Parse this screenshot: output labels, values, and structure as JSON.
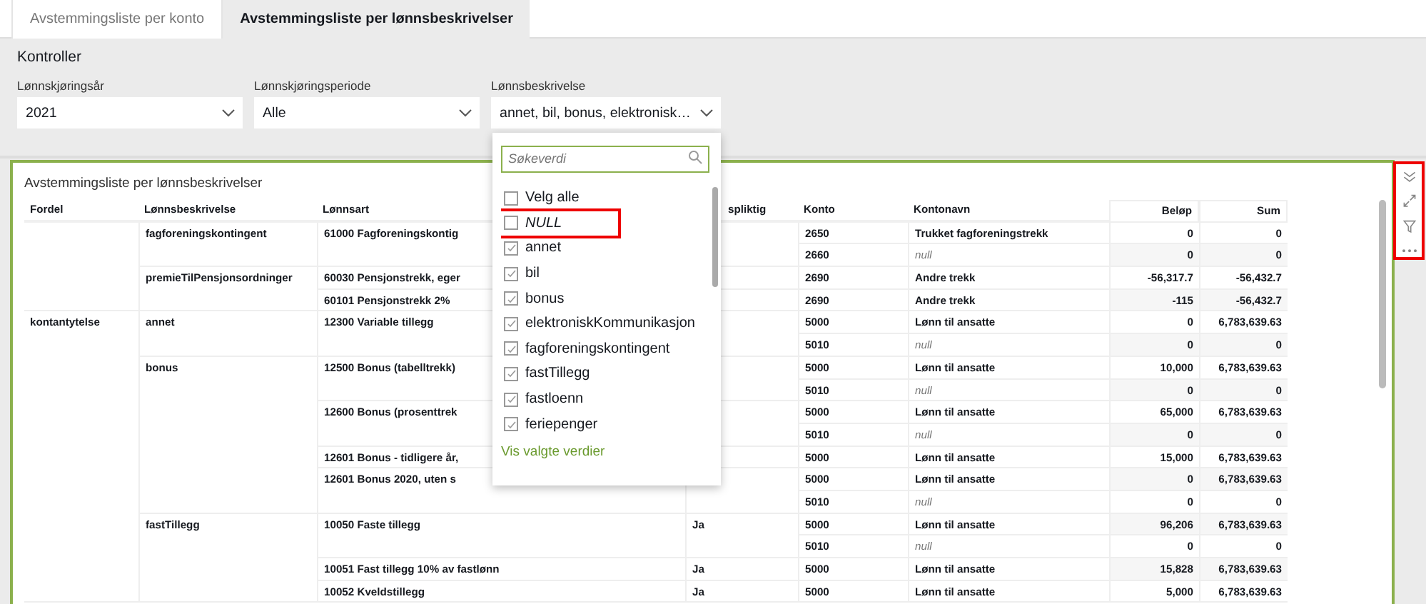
{
  "tabs": [
    {
      "label": "Avstemmingsliste per konto",
      "selected": false
    },
    {
      "label": "Avstemmingsliste per lønnsbeskrivelser",
      "selected": true
    }
  ],
  "controls": {
    "title": "Kontroller",
    "filters": [
      {
        "label": "Lønnskjøringsår",
        "value": "2021"
      },
      {
        "label": "Lønnskjøringsperiode",
        "value": "Alle"
      },
      {
        "label": "Lønnsbeskrivelse",
        "value": "annet, bil, bonus, elektronisk…"
      }
    ]
  },
  "dropdown": {
    "placeholder": "Søkeverdi",
    "options": [
      {
        "label": "Velg alle",
        "kind": "value",
        "checked": false,
        "highlighted": false
      },
      {
        "label": "NULL",
        "kind": "empty",
        "checked": false,
        "highlighted": true
      },
      {
        "label": "annet",
        "kind": "value",
        "checked": true,
        "highlighted": false
      },
      {
        "label": "bil",
        "kind": "value",
        "checked": true,
        "highlighted": false
      },
      {
        "label": "bonus",
        "kind": "value",
        "checked": true,
        "highlighted": false
      },
      {
        "label": "elektroniskKommunikasjon",
        "kind": "value",
        "checked": true,
        "highlighted": false
      },
      {
        "label": "fagforeningskontingent",
        "kind": "value",
        "checked": true,
        "highlighted": false
      },
      {
        "label": "fastTillegg",
        "kind": "value",
        "checked": true,
        "highlighted": false
      },
      {
        "label": "fastloenn",
        "kind": "value",
        "checked": true,
        "highlighted": false
      },
      {
        "label": "feriepenger",
        "kind": "value",
        "checked": true,
        "highlighted": false
      }
    ],
    "footer_link": "Vis valgte verdier"
  },
  "panel": {
    "title": "Avstemmingsliste per lønnsbeskrivelser",
    "toolbar_highlighted": true,
    "table": {
      "columns": [
        "Fordel",
        "Lønnsbeskrivelse",
        "Lønnsart",
        "spliktig",
        "Konto",
        "Kontonavn",
        "Beløp",
        "Sum"
      ],
      "groups": [
        {
          "descriptions": [
            {
              "name": "fagforeningskontingent",
              "types": [
                {
                  "name": "61000 Fagforeningskontig",
                  "accounts": [
                    {
                      "konto": "2650",
                      "kontonavn": "Trukket fagforeningstrekk",
                      "name_missing": false,
                      "belop": "0",
                      "sum": "0"
                    },
                    {
                      "konto": "2660",
                      "kontonavn": "null",
                      "name_missing": true,
                      "belop": "0",
                      "sum": "0"
                    }
                  ]
                }
              ]
            },
            {
              "name": "premieTilPensjonsordninger",
              "types": [
                {
                  "name": "60030 Pensjonstrekk, eger",
                  "accounts": [
                    {
                      "konto": "2690",
                      "kontonavn": "Andre trekk",
                      "name_missing": false,
                      "belop": "-56,317.7",
                      "sum": "-56,432.7"
                    }
                  ]
                },
                {
                  "name": "60101 Pensjonstrekk 2%",
                  "accounts": [
                    {
                      "konto": "2690",
                      "kontonavn": "Andre trekk",
                      "name_missing": false,
                      "belop": "-115",
                      "sum": "-56,432.7"
                    }
                  ]
                }
              ]
            }
          ]
        },
        {
          "fordel": "kontantytelse",
          "descriptions": [
            {
              "name": "annet",
              "types": [
                {
                  "name": "12300 Variable tillegg",
                  "accounts": [
                    {
                      "konto": "5000",
                      "kontonavn": "Lønn til ansatte",
                      "name_missing": false,
                      "belop": "0",
                      "sum": "6,783,639.63"
                    },
                    {
                      "konto": "5010",
                      "kontonavn": "null",
                      "name_missing": true,
                      "belop": "0",
                      "sum": "0"
                    }
                  ]
                }
              ]
            },
            {
              "name": "bonus",
              "types": [
                {
                  "name": "12500 Bonus (tabelltrekk)",
                  "accounts": [
                    {
                      "konto": "5000",
                      "kontonavn": "Lønn til ansatte",
                      "name_missing": false,
                      "belop": "10,000",
                      "sum": "6,783,639.63"
                    },
                    {
                      "konto": "5010",
                      "kontonavn": "null",
                      "name_missing": true,
                      "belop": "0",
                      "sum": "0"
                    }
                  ]
                },
                {
                  "name": "12600 Bonus (prosenttrek",
                  "accounts": [
                    {
                      "konto": "5000",
                      "kontonavn": "Lønn til ansatte",
                      "name_missing": false,
                      "belop": "65,000",
                      "sum": "6,783,639.63"
                    },
                    {
                      "konto": "5010",
                      "kontonavn": "null",
                      "name_missing": true,
                      "belop": "0",
                      "sum": "0"
                    }
                  ]
                },
                {
                  "name": "12601 Bonus - tidligere år,",
                  "accounts": [
                    {
                      "konto": "5000",
                      "kontonavn": "Lønn til ansatte",
                      "name_missing": false,
                      "belop": "15,000",
                      "sum": "6,783,639.63"
                    }
                  ]
                },
                {
                  "name": "12601 Bonus 2020, uten s",
                  "accounts": [
                    {
                      "konto": "5000",
                      "kontonavn": "Lønn til ansatte",
                      "name_missing": false,
                      "belop": "0",
                      "sum": "6,783,639.63"
                    },
                    {
                      "konto": "5010",
                      "kontonavn": "null",
                      "name_missing": true,
                      "belop": "0",
                      "sum": "0"
                    }
                  ]
                }
              ]
            },
            {
              "name": "fastTillegg",
              "types": [
                {
                  "name": "10050 Faste tillegg",
                  "column_4": "Ja",
                  "accounts": [
                    {
                      "konto": "5000",
                      "kontonavn": "Lønn til ansatte",
                      "name_missing": false,
                      "belop": "96,206",
                      "sum": "6,783,639.63"
                    },
                    {
                      "konto": "5010",
                      "kontonavn": "null",
                      "name_missing": true,
                      "belop": "0",
                      "sum": "0"
                    }
                  ]
                },
                {
                  "name": "10051 Fast tillegg 10% av fastlønn",
                  "column_4": "Ja",
                  "accounts": [
                    {
                      "konto": "5000",
                      "kontonavn": "Lønn til ansatte",
                      "name_missing": false,
                      "belop": "15,828",
                      "sum": "6,783,639.63"
                    }
                  ]
                },
                {
                  "name": "10052 Kveldstillegg",
                  "column_4": "Ja",
                  "accounts": [
                    {
                      "konto": "5000",
                      "kontonavn": "Lønn til ansatte",
                      "name_missing": false,
                      "belop": "5,000",
                      "sum": "6,783,639.63"
                    }
                  ]
                }
              ]
            }
          ]
        }
      ]
    }
  }
}
